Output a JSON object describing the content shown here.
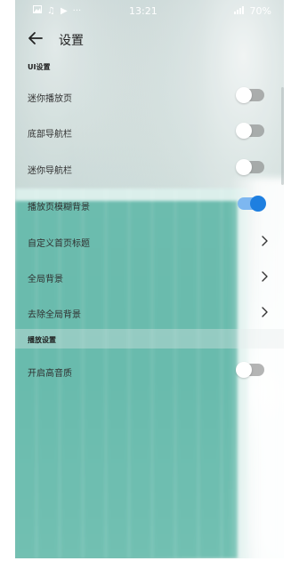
{
  "status_bar": {
    "left_icons": [
      "image-icon",
      "music-icon",
      "play-icon",
      "more-icon"
    ],
    "time": "13:21",
    "battery": "70%"
  },
  "header": {
    "title": "设置"
  },
  "sections": [
    {
      "title": "UI设置",
      "rows": [
        {
          "label": "迷你播放页",
          "control": "toggle",
          "on": false
        },
        {
          "label": "底部导航栏",
          "control": "toggle",
          "on": false
        },
        {
          "label": "迷你导航栏",
          "control": "toggle",
          "on": false
        },
        {
          "label": "播放页模糊背景",
          "control": "toggle",
          "on": true
        },
        {
          "label": "自定义首页标题",
          "control": "chevron"
        },
        {
          "label": "全局背景",
          "control": "chevron"
        },
        {
          "label": "去除全局背景",
          "control": "chevron"
        }
      ]
    },
    {
      "title": "播放设置",
      "rows": [
        {
          "label": "开启高音质",
          "control": "toggle",
          "on": false
        }
      ]
    }
  ],
  "colors": {
    "toggle_on": "#1e7fe0",
    "toggle_on_track": "#7db7f0",
    "toggle_off_track": "#8a8a8a"
  }
}
